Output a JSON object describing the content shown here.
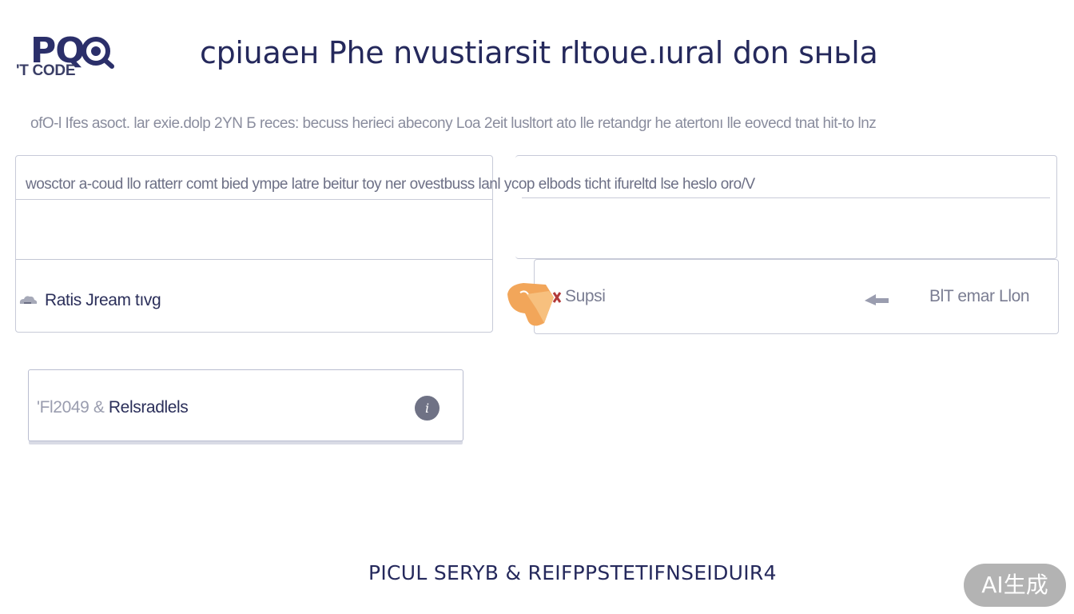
{
  "header": {
    "logo_text": "PQ",
    "title": "cpiuaeн Phe nvustiаrsit rltoue.ıural don sньla"
  },
  "subtitle": "ofO‑l Ifes asoct. lar exie.dolp 2YN Б reces: becuss herieci abecony Loa 2eit lusltort ato lle retandgr he atertonı lle eovecd tnat hit‑to lnz",
  "description": "wosctor a‑coud llo ratterr comt bied ympe latre beitur toy ner ovestbuss lanl ycop elbods ticht ifureltd lse heslo oro/V",
  "card_left": {
    "code_label": "'T CODE",
    "stream_label": "Ratis Jream tıvg"
  },
  "card_right": {
    "support_label": "Supsi",
    "email_label": "BlT emar Llon"
  },
  "resources": {
    "prefix": "'Fl2049 &",
    "label": "Relsradlels",
    "info_glyph": "i"
  },
  "footer": {
    "link_text": "PICUL SERYB & REIFPPSTETIFNSEIDUIR4"
  },
  "badge": {
    "text": "AI生成"
  },
  "colors": {
    "brand": "#2b2f6a",
    "accent_orange": "#f2a65a",
    "border": "#c7cad8",
    "muted_text": "#8a8d9e"
  },
  "icons": {
    "logo": "magnifier-logo-icon",
    "stream": "cloud-arrow-icon",
    "support": "support-box-icon",
    "arrow": "send-arrow-icon",
    "info": "info-icon"
  }
}
